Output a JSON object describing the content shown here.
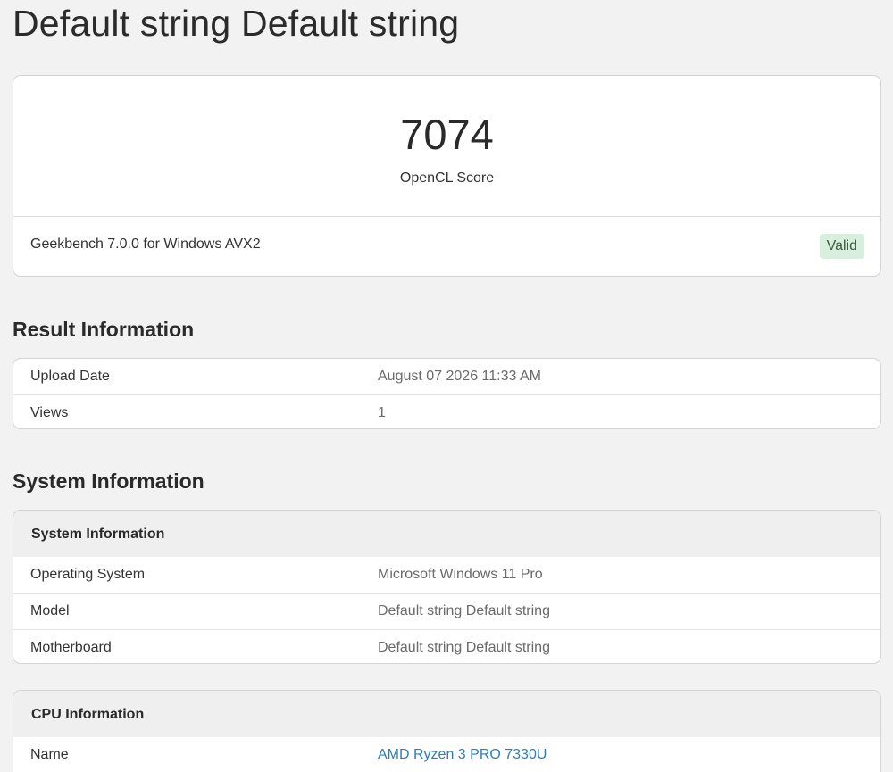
{
  "page": {
    "title": "Default string Default string"
  },
  "score": {
    "value": "7074",
    "label": "OpenCL Score",
    "version": "Geekbench 7.0.0 for Windows AVX2",
    "status": "Valid",
    "status_color": "#d8efdd"
  },
  "result_info": {
    "heading": "Result Information",
    "rows": [
      {
        "key": "Upload Date",
        "value": "August 07 2026 11:33 AM"
      },
      {
        "key": "Views",
        "value": "1"
      }
    ]
  },
  "system_info": {
    "heading": "System Information",
    "card_title": "System Information",
    "rows": [
      {
        "key": "Operating System",
        "value": "Microsoft Windows 11 Pro"
      },
      {
        "key": "Model",
        "value": "Default string Default string"
      },
      {
        "key": "Motherboard",
        "value": "Default string Default string"
      }
    ]
  },
  "cpu_info": {
    "card_title": "CPU Information",
    "rows": [
      {
        "key": "Name",
        "value": "AMD Ryzen 3 PRO 7330U"
      }
    ]
  },
  "colors": {
    "link": "#2a7fb8",
    "background": "#f2f2f2"
  }
}
